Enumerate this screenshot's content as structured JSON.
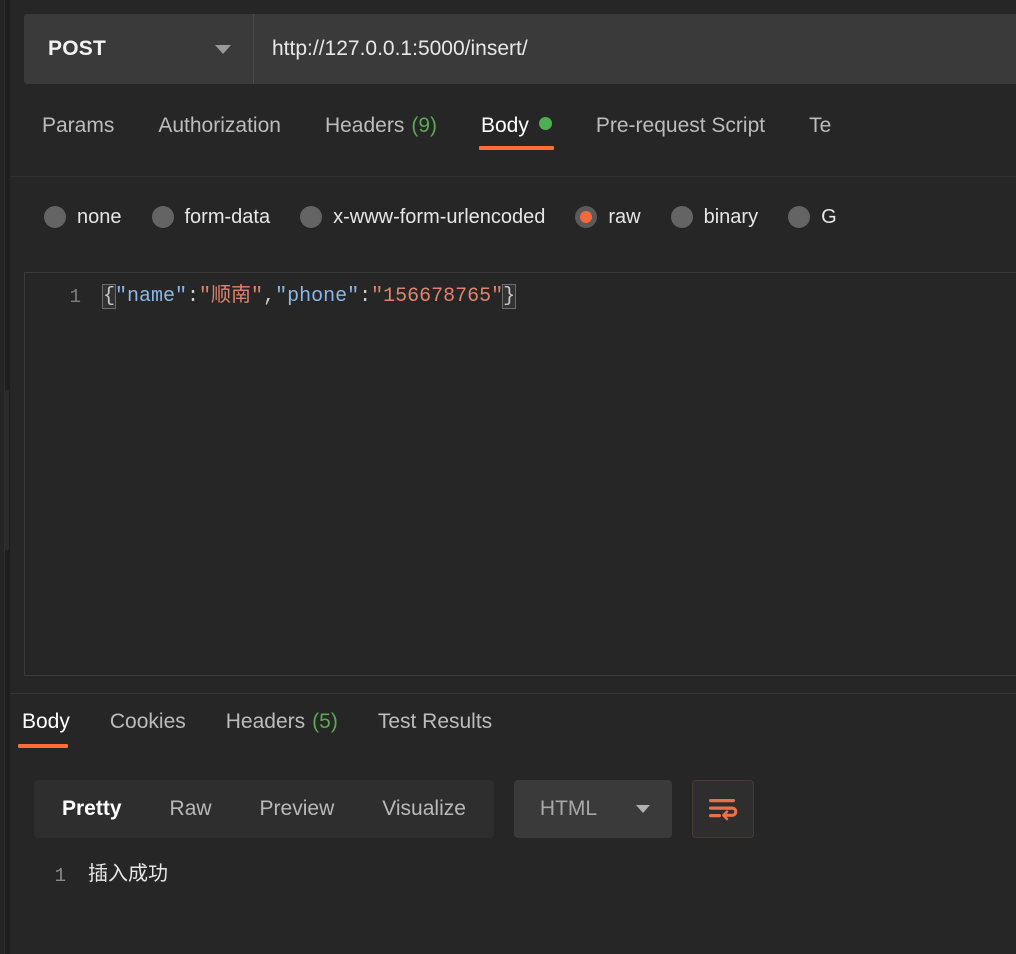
{
  "request": {
    "method": "POST",
    "method_caret_icon": "chevron-down-icon",
    "url": "http://127.0.0.1:5000/insert/",
    "tabs": [
      {
        "label": "Params",
        "count": "",
        "active": false,
        "dot": false
      },
      {
        "label": "Authorization",
        "count": "",
        "active": false,
        "dot": false
      },
      {
        "label": "Headers",
        "count": "(9)",
        "active": false,
        "dot": false
      },
      {
        "label": "Body",
        "count": "",
        "active": true,
        "dot": true
      },
      {
        "label": "Pre-request Script",
        "count": "",
        "active": false,
        "dot": false
      },
      {
        "label": "Te",
        "count": "",
        "active": false,
        "dot": false
      }
    ],
    "body_types": [
      {
        "label": "none",
        "selected": false
      },
      {
        "label": "form-data",
        "selected": false
      },
      {
        "label": "x-www-form-urlencoded",
        "selected": false
      },
      {
        "label": "raw",
        "selected": true
      },
      {
        "label": "binary",
        "selected": false
      },
      {
        "label": "G",
        "selected": false
      }
    ],
    "editor": {
      "line_number": "1",
      "open_brace": "{",
      "key_name": "\"name\"",
      "colon1": ":",
      "value_name": "\"顺南\"",
      "comma": ",",
      "key_phone": "\"phone\"",
      "colon2": ":",
      "value_phone": "\"156678765\"",
      "close_brace": "}"
    }
  },
  "response": {
    "tabs": [
      {
        "label": "Body",
        "count": "",
        "active": true
      },
      {
        "label": "Cookies",
        "count": "",
        "active": false
      },
      {
        "label": "Headers",
        "count": "(5)",
        "active": false
      },
      {
        "label": "Test Results",
        "count": "",
        "active": false
      }
    ],
    "format_buttons": [
      {
        "label": "Pretty",
        "active": true
      },
      {
        "label": "Raw",
        "active": false
      },
      {
        "label": "Preview",
        "active": false
      },
      {
        "label": "Visualize",
        "active": false
      }
    ],
    "language": "HTML",
    "language_caret_icon": "chevron-down-icon",
    "wrap_toggle_icon": "word-wrap-icon",
    "body": {
      "line_number": "1",
      "text": "插入成功"
    }
  },
  "colors": {
    "accent": "#ff6c37",
    "status_dot": "#4caf50",
    "count_green": "#5aa84f",
    "json_key": "#8ab8e6",
    "json_string": "#e0836e",
    "panel_bg": "#262626",
    "field_bg": "#3a3a3a"
  }
}
